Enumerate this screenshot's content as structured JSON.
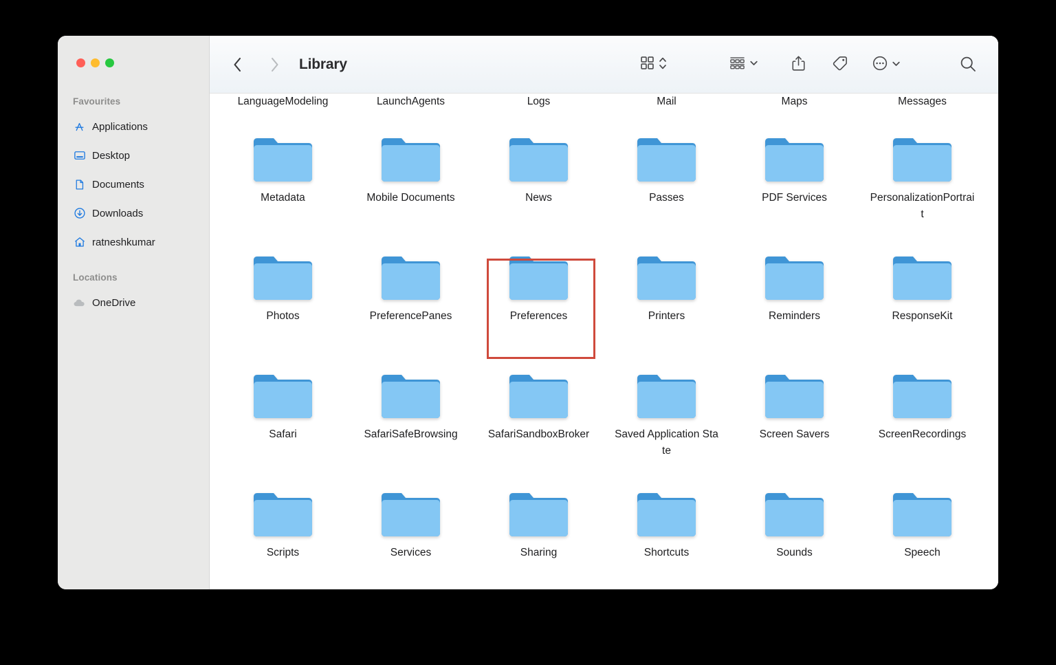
{
  "window": {
    "title": "Library",
    "traffic_lights": [
      {
        "name": "close",
        "color": "#ff5f57"
      },
      {
        "name": "minimize",
        "color": "#febc2e"
      },
      {
        "name": "maximize",
        "color": "#28c840"
      }
    ]
  },
  "toolbar": {
    "back_label": "Back",
    "forward_label": "Forward",
    "title": "Library",
    "items": [
      {
        "name": "view-mode",
        "label": "Icon View",
        "icon": "grid-icon",
        "has_chevron": true,
        "chevron": "updown"
      },
      {
        "name": "group-by",
        "label": "Group By",
        "icon": "group-list-icon",
        "has_chevron": true,
        "chevron": "down"
      },
      {
        "name": "share",
        "label": "Share",
        "icon": "share-icon",
        "has_chevron": false
      },
      {
        "name": "tags",
        "label": "Tags",
        "icon": "tag-icon",
        "has_chevron": false
      },
      {
        "name": "more",
        "label": "More",
        "icon": "ellipsis-circle-icon",
        "has_chevron": true,
        "chevron": "down"
      },
      {
        "name": "search",
        "label": "Search",
        "icon": "search-icon",
        "has_chevron": false
      }
    ]
  },
  "sidebar": {
    "sections": [
      {
        "header": "Favourites",
        "items": [
          {
            "label": "Applications",
            "icon": "applications-icon"
          },
          {
            "label": "Desktop",
            "icon": "desktop-icon"
          },
          {
            "label": "Documents",
            "icon": "document-icon"
          },
          {
            "label": "Downloads",
            "icon": "downloads-icon"
          },
          {
            "label": "ratneshkumar",
            "icon": "home-icon"
          }
        ]
      },
      {
        "header": "Locations",
        "items": [
          {
            "label": "OneDrive",
            "icon": "cloud-icon"
          }
        ]
      }
    ]
  },
  "content": {
    "rows": [
      {
        "type": "labels-only",
        "cells": [
          {
            "label": "LanguageModeling"
          },
          {
            "label": "LaunchAgents"
          },
          {
            "label": "Logs"
          },
          {
            "label": "Mail"
          },
          {
            "label": "Maps"
          },
          {
            "label": "Messages"
          }
        ]
      },
      {
        "type": "folders",
        "cells": [
          {
            "label": "Metadata"
          },
          {
            "label": "Mobile Documents"
          },
          {
            "label": "News"
          },
          {
            "label": "Passes"
          },
          {
            "label": "PDF Services"
          },
          {
            "label": "PersonalizationPortrait"
          }
        ]
      },
      {
        "type": "folders",
        "cells": [
          {
            "label": "Photos"
          },
          {
            "label": "PreferencePanes"
          },
          {
            "label": "Preferences",
            "highlighted": true
          },
          {
            "label": "Printers"
          },
          {
            "label": "Reminders"
          },
          {
            "label": "ResponseKit"
          }
        ]
      },
      {
        "type": "folders",
        "cells": [
          {
            "label": "Safari"
          },
          {
            "label": "SafariSafeBrowsing"
          },
          {
            "label": "SafariSandboxBroker"
          },
          {
            "label": "Saved Application State"
          },
          {
            "label": "Screen Savers"
          },
          {
            "label": "ScreenRecordings"
          }
        ]
      },
      {
        "type": "folders",
        "cells": [
          {
            "label": "Scripts"
          },
          {
            "label": "Services"
          },
          {
            "label": "Sharing"
          },
          {
            "label": "Shortcuts"
          },
          {
            "label": "Sounds"
          },
          {
            "label": "Speech"
          }
        ]
      }
    ]
  },
  "annotation": {
    "type": "highlight-rectangle",
    "target": "Preferences",
    "color": "#cf4a3c"
  },
  "colors": {
    "folder_body": "#84c7f4",
    "folder_tab": "#3f95d6",
    "sidebar_bg": "#e9e9e8",
    "content_bg": "#ffffff",
    "accent_blue": "#1f7ae0",
    "highlight": "#cf4a3c"
  }
}
